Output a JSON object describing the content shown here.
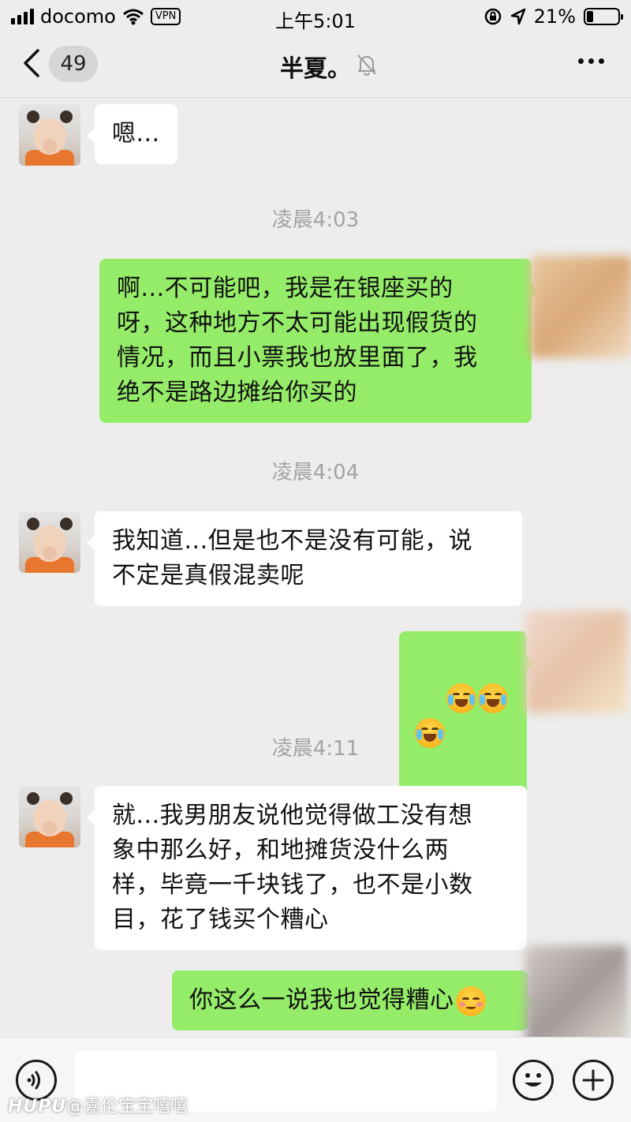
{
  "status_bar": {
    "carrier": "docomo",
    "vpn_label": "VPN",
    "time": "上午5:01",
    "battery_percent_text": "21%",
    "battery_level": 0.21
  },
  "nav": {
    "unread_count": "49",
    "title": "半夏。"
  },
  "messages": [
    {
      "side": "in",
      "text": "嗯..."
    },
    {
      "timestamp": "凌晨4:03"
    },
    {
      "side": "out",
      "text": "啊...不可能吧，我是在银座买的\n呀，这种地方不太可能出现假货的\n情况，而且小票我也放里面了，我\n绝不是路边摊给你买的"
    },
    {
      "timestamp": "凌晨4:04"
    },
    {
      "side": "in",
      "text": "我知道...但是也不是没有可能，说\n不定是真假混卖呢"
    },
    {
      "side": "out",
      "emoji": [
        "face-crying-laughing",
        "face-crying-laughing",
        "face-crying-laughing"
      ]
    },
    {
      "timestamp": "凌晨4:11"
    },
    {
      "side": "in",
      "text": "就...我男朋友说他觉得做工没有想\n象中那么好，和地摊货没什么两\n样，毕竟一千块钱了，也不是小数\n目，花了钱买个糟心"
    },
    {
      "side": "out",
      "text": "你这么一说我也觉得糟心",
      "emoji": [
        "face-blushing-smile"
      ]
    }
  ],
  "input": {
    "value": "",
    "placeholder": ""
  },
  "watermark": {
    "brand": "HUPU",
    "handle": "@嘉伦宝宝嘻嘻"
  },
  "colors": {
    "background": "#ededed",
    "bubble_out": "#95ec69",
    "bubble_in": "#ffffff",
    "timestamp": "#a3a3a3"
  }
}
